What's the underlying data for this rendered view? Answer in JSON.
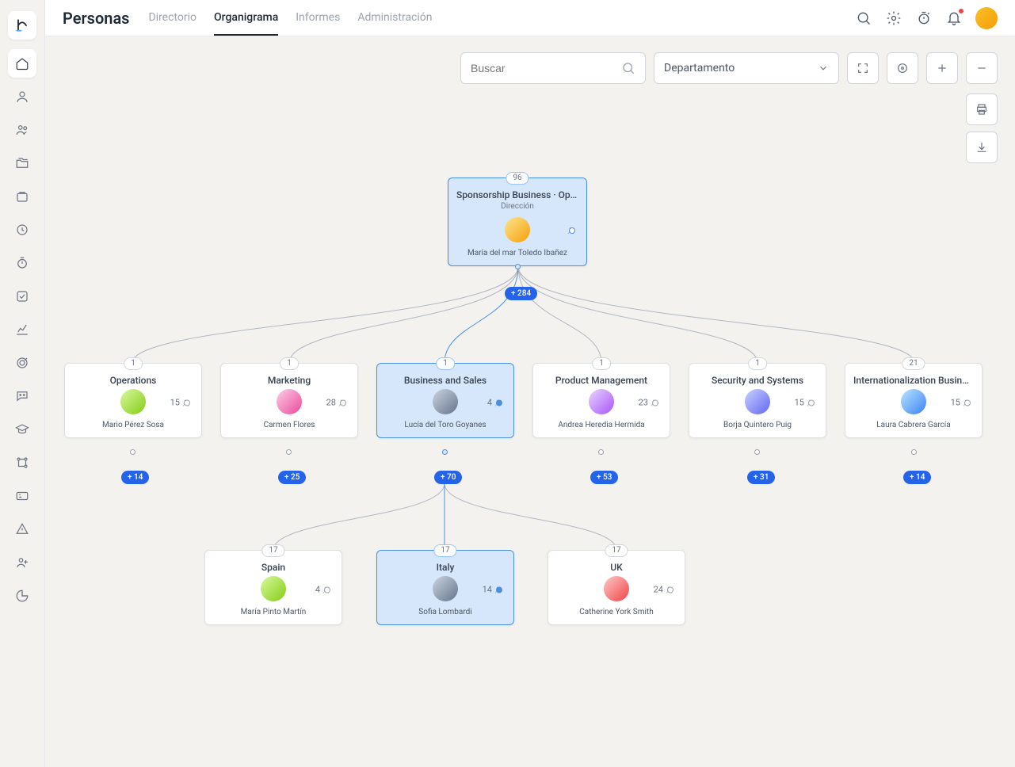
{
  "page_title": "Personas",
  "tabs": {
    "directorio": "Directorio",
    "organigrama": "Organigrama",
    "informes": "Informes",
    "administracion": "Administración"
  },
  "search": {
    "placeholder": "Buscar"
  },
  "filter": {
    "label": "Departamento"
  },
  "root": {
    "badge": "96",
    "title": "Sponsorship Business · Operati...",
    "subtitle": "Dirección",
    "owner": "María del mar Toledo Ibañez",
    "expand": "+ 284"
  },
  "level1": [
    {
      "badge": "1",
      "title": "Operations",
      "count": "15",
      "owner": "Mario Pérez Sosa",
      "expand": "+ 14"
    },
    {
      "badge": "1",
      "title": "Marketing",
      "count": "28",
      "owner": "Carmen Flores",
      "expand": "+ 25"
    },
    {
      "badge": "1",
      "title": "Business and Sales",
      "count": "4",
      "owner": "Lucía del Toro Goyanes",
      "expand": "+ 70",
      "selected": true
    },
    {
      "badge": "1",
      "title": "Product Management",
      "count": "23",
      "owner": "Andrea Heredia Hermida",
      "expand": "+ 53"
    },
    {
      "badge": "1",
      "title": "Security and Systems",
      "count": "15",
      "owner": "Borja Quintero Puig",
      "expand": "+ 31"
    },
    {
      "badge": "21",
      "title": "Internationalization Business St...",
      "count": "15",
      "owner": "Laura Cabrera García",
      "expand": "+ 14"
    }
  ],
  "level2": [
    {
      "badge": "17",
      "title": "Spain",
      "count": "4",
      "owner": "María Pinto Martín"
    },
    {
      "badge": "17",
      "title": "Italy",
      "count": "14",
      "owner": "Sofia Lombardi",
      "selected": true
    },
    {
      "badge": "17",
      "title": "UK",
      "count": "24",
      "owner": "Catherine York Smith"
    }
  ]
}
